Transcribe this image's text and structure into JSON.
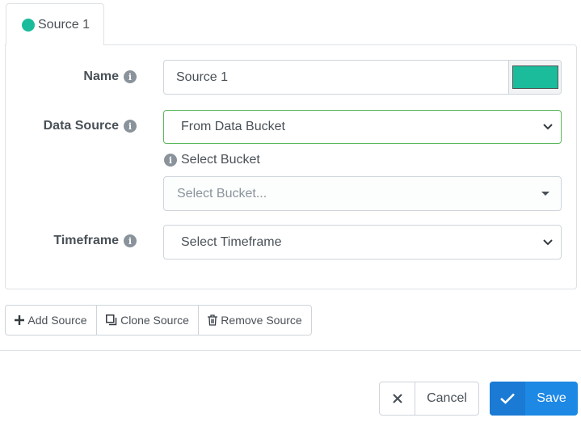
{
  "tab": {
    "label": "Source 1",
    "dot_color": "#1abc9c"
  },
  "form": {
    "name": {
      "label": "Name",
      "value": "Source 1",
      "color": "#1abc9c"
    },
    "data_source": {
      "label": "Data Source",
      "value": "From Data Bucket"
    },
    "bucket": {
      "label": "Select Bucket",
      "placeholder": "Select Bucket..."
    },
    "timeframe": {
      "label": "Timeframe",
      "value": "Select Timeframe"
    }
  },
  "actions": {
    "add_source": "Add Source",
    "clone_source": "Clone Source",
    "remove_source": "Remove Source"
  },
  "footer": {
    "cancel": "Cancel",
    "save": "Save"
  },
  "icons": {
    "info": "info-icon",
    "plus": "plus-icon",
    "clone": "clone-icon",
    "trash": "trash-icon",
    "close": "close-icon",
    "check": "check-icon",
    "chevron": "chevron-down-icon"
  },
  "colors": {
    "accent": "#1e88e5",
    "valid_border": "#5cb85c",
    "swatch": "#1abc9c"
  }
}
